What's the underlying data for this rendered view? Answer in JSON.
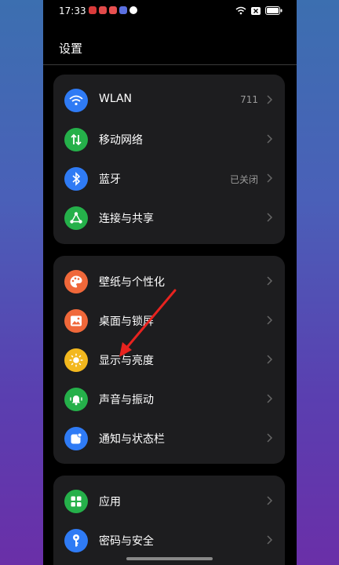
{
  "status": {
    "time": "17:33"
  },
  "page": {
    "title": "设置"
  },
  "groups": [
    {
      "items": [
        {
          "label": "WLAN",
          "value": "711",
          "icon": "wifi-icon",
          "color": "#2f7bf5"
        },
        {
          "label": "移动网络",
          "value": "",
          "icon": "mobile-data-icon",
          "color": "#25b04a"
        },
        {
          "label": "蓝牙",
          "value": "已关闭",
          "icon": "bluetooth-icon",
          "color": "#2f7bf5"
        },
        {
          "label": "连接与共享",
          "value": "",
          "icon": "share-connection-icon",
          "color": "#25b04a"
        }
      ]
    },
    {
      "items": [
        {
          "label": "壁纸与个性化",
          "value": "",
          "icon": "palette-icon",
          "color": "#f0683a"
        },
        {
          "label": "桌面与锁屏",
          "value": "",
          "icon": "image-icon",
          "color": "#f0683a"
        },
        {
          "label": "显示与亮度",
          "value": "",
          "icon": "sun-icon",
          "color": "#f3b81e"
        },
        {
          "label": "声音与振动",
          "value": "",
          "icon": "bell-icon",
          "color": "#25b04a"
        },
        {
          "label": "通知与状态栏",
          "value": "",
          "icon": "notification-icon",
          "color": "#2f7bf5"
        }
      ]
    },
    {
      "items": [
        {
          "label": "应用",
          "value": "",
          "icon": "apps-grid-icon",
          "color": "#25b04a"
        },
        {
          "label": "密码与安全",
          "value": "",
          "icon": "key-icon",
          "color": "#2f7bf5"
        }
      ]
    }
  ]
}
